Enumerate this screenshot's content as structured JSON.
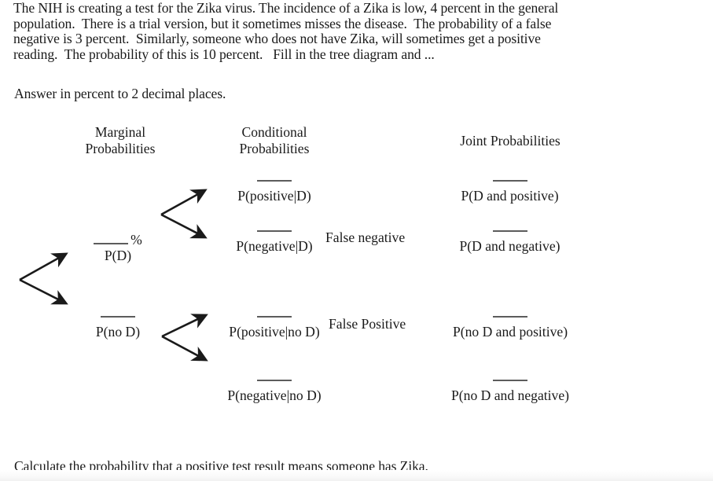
{
  "problem": {
    "intro": "The NIH is creating a test for the Zika virus. The incidence of a Zika is low, 4 percent in the general\npopulation.  There is a trial version, but it sometimes misses the disease.  The probability of a false\nnegative is 3 percent.  Similarly, someone who does not have Zika, will sometimes get a positive\nreading.  The probability of this is 10 percent.   Fill in the tree diagram and ...",
    "answer_instruction": "Answer in percent to 2 decimal places.",
    "closing_question": "Calculate the probability that a positive test result means someone has Zika."
  },
  "diagram": {
    "headers": {
      "marginal_line1": "Marginal",
      "marginal_line2": "Probabilities",
      "conditional_line1": "Conditional",
      "conditional_line2": "Probabilities",
      "joint": "Joint Probabilities"
    },
    "marginal": [
      {
        "blank": "",
        "percent": "%",
        "label": "P(D)"
      },
      {
        "blank": "",
        "label": "P(no D)"
      }
    ],
    "conditional": [
      {
        "blank": "",
        "label": "P(positive|D)"
      },
      {
        "blank": "",
        "label": "P(negative|D)"
      },
      {
        "blank": "",
        "label": "P(positive|no D)"
      },
      {
        "blank": "",
        "label": "P(negative|no D)"
      }
    ],
    "joint": [
      {
        "blank": "",
        "label": "P(D and positive)"
      },
      {
        "blank": "",
        "label": "P(D and negative)"
      },
      {
        "blank": "",
        "label": "P(no D and positive)"
      },
      {
        "blank": "",
        "label": "P(no D and negative)"
      }
    ],
    "annotations": {
      "false_negative": "False negative",
      "false_positive": "False Positive"
    }
  },
  "colors": {
    "text": "#1a1a1a",
    "blank_line": "#5c5c5c",
    "arrow": "#1a1a1a",
    "background": "#ffffff"
  }
}
